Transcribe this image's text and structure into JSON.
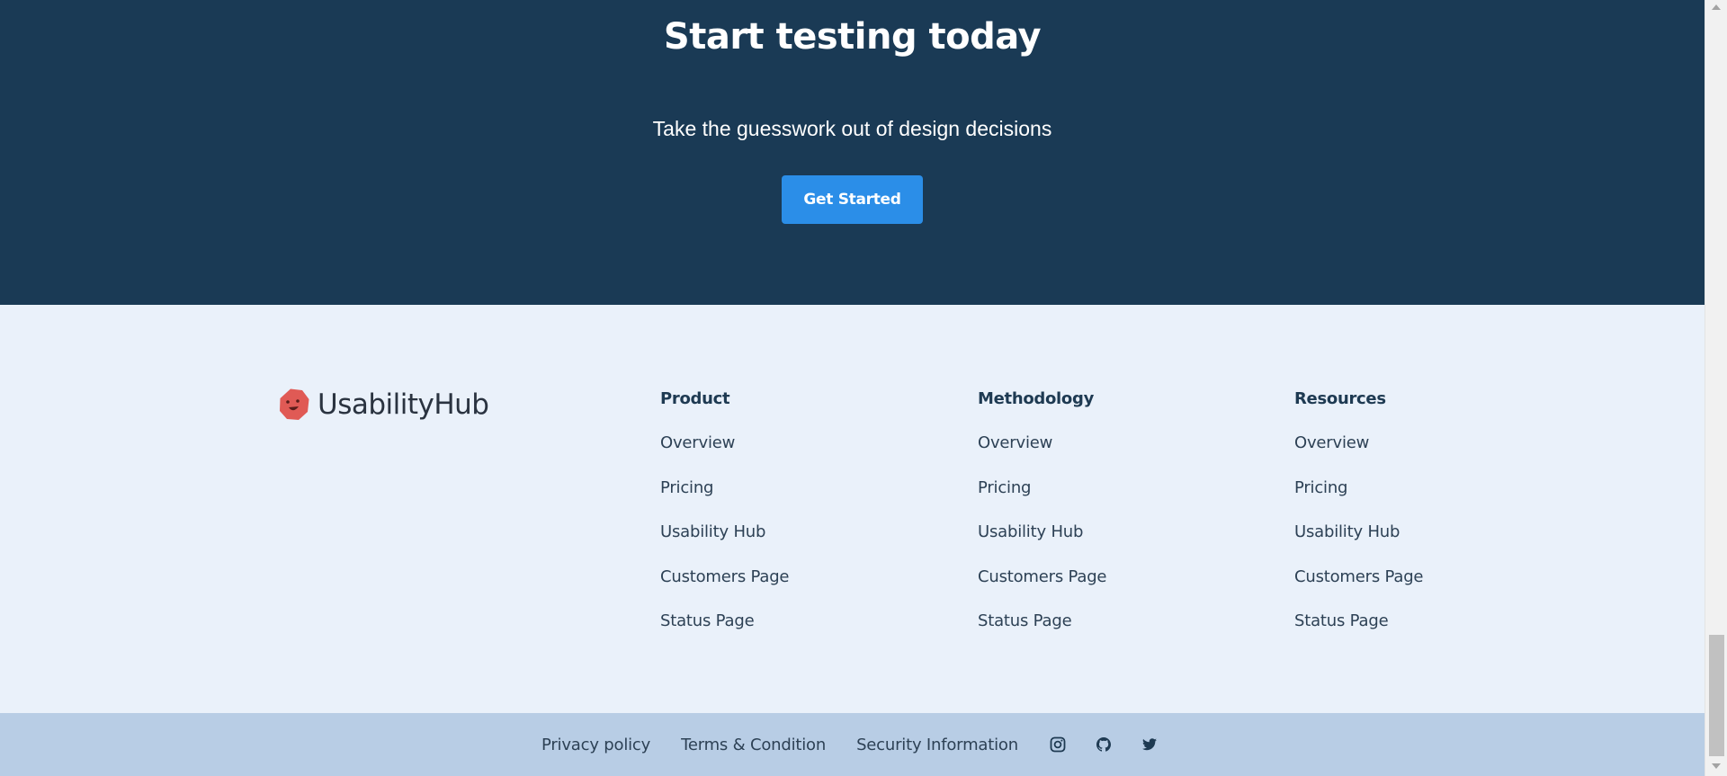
{
  "cta": {
    "title": "Start testing today",
    "subtitle": "Take the guesswork out of design decisions",
    "button_label": "Get Started",
    "background_color": "#1a3a55",
    "button_color": "#2b8ee8"
  },
  "brand": {
    "name": "UsabilityHub",
    "logo_icon": "usabilityhub-logo-icon",
    "logo_color": "#e05a55"
  },
  "columns": [
    {
      "heading": "Product",
      "links": [
        "Overview",
        "Pricing",
        "Usability Hub",
        "Customers Page",
        "Status Page"
      ]
    },
    {
      "heading": "Methodology",
      "links": [
        "Overview",
        "Pricing",
        "Usability Hub",
        "Customers Page",
        "Status Page"
      ]
    },
    {
      "heading": "Resources",
      "links": [
        "Overview",
        "Pricing",
        "Usability Hub",
        "Customers Page",
        "Status Page"
      ]
    }
  ],
  "bottom_bar": {
    "links": [
      "Privacy policy",
      "Terms & Condition",
      "Security Information"
    ],
    "social_icons": [
      "instagram-icon",
      "github-icon",
      "twitter-icon"
    ],
    "background_color": "#b8cde5"
  },
  "scrollbar": {
    "scroll_position_fraction": 0.87
  }
}
